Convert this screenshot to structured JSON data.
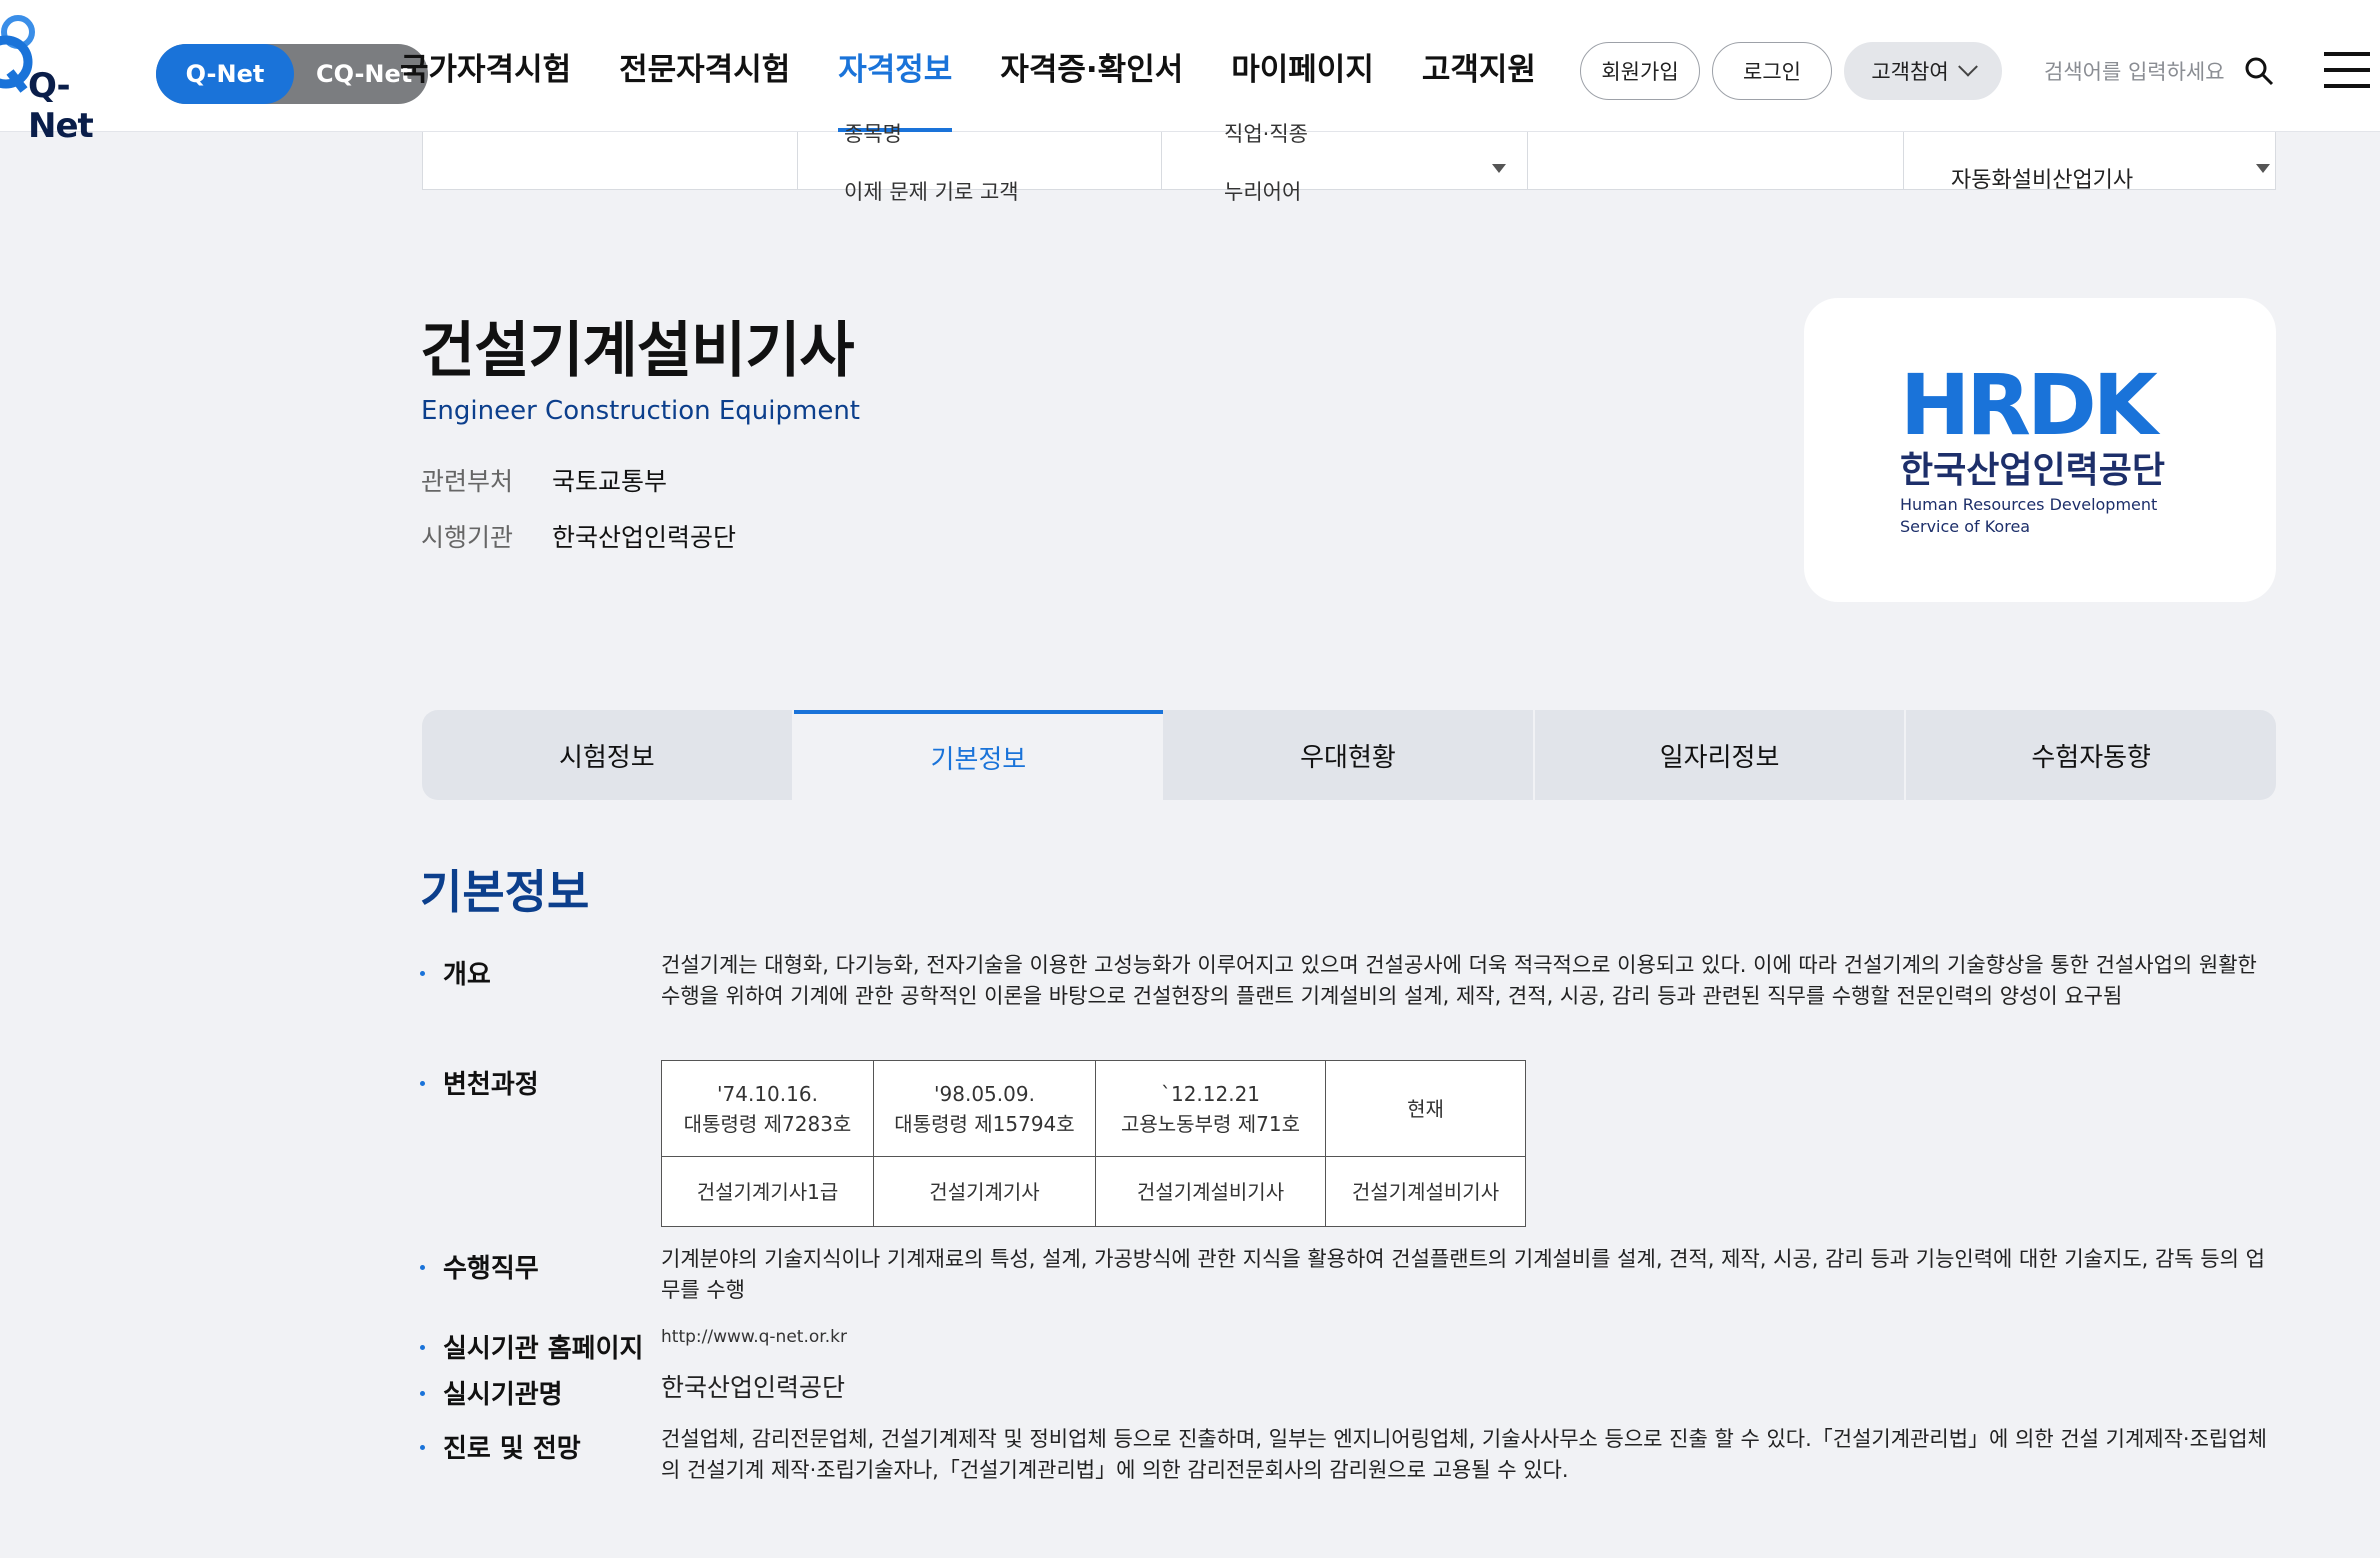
{
  "header": {
    "logo_text": "Q-Net",
    "net_switch": {
      "active": "Q-Net",
      "inactive": "CQ-Net"
    },
    "gnb": [
      "국가자격시험",
      "전문자격시험",
      "자격정보",
      "자격증·확인서",
      "마이페이지",
      "고객지원"
    ],
    "gnb_active_index": 2,
    "signup": "회원가입",
    "login": "로그인",
    "participation": "고객참여",
    "search_placeholder": "검색어를 입력하세요"
  },
  "form_strip": {
    "cut_text_1": "종목명",
    "cut_text_2": "직업·직종",
    "cut_text_3": "이제 문제 기로 고객",
    "cut_text_4": "누리어어",
    "selected_item": "자동화설비산업기사"
  },
  "qualification": {
    "title": "건설기계설비기사",
    "subtitle": "Engineer Construction Equipment",
    "meta": [
      {
        "label": "관련부처",
        "value": "국토교통부"
      },
      {
        "label": "시행기관",
        "value": "한국산업인력공단"
      }
    ],
    "org_logo": {
      "mark": "HRDK",
      "name_ko": "한국산업인력공단",
      "name_en_1": "Human Resources Development",
      "name_en_2": "Service of Korea",
      "color": "#1a73d9"
    }
  },
  "tabs": [
    "시험정보",
    "기본정보",
    "우대현황",
    "일자리정보",
    "수험자동향"
  ],
  "tabs_active_index": 1,
  "basic_info": {
    "section_title": "기본정보",
    "overview_label": "개요",
    "overview_text": "건설기계는 대형화, 다기능화, 전자기술을 이용한 고성능화가 이루어지고 있으며 건설공사에 더욱 적극적으로 이용되고 있다. 이에 따라 건설기계의 기술향상을 통한 건설사업의 원활한 수행을 위하여 기계에 관한 공학적인 이론을 바탕으로 건설현장의 플랜트 기계설비의 설계, 제작, 견적, 시공, 감리 등과 관련된 직무를 수행할 전문인력의 양성이 요구됨",
    "history_label": "변천과정",
    "history": [
      {
        "date": "'74.10.16.",
        "law": "대통령령 제7283호",
        "name": "건설기계기사1급"
      },
      {
        "date": "'98.05.09.",
        "law": "대통령령 제15794호",
        "name": "건설기계기사"
      },
      {
        "date": "`12.12.21",
        "law": "고용노동부령 제71호",
        "name": "건설기계설비기사"
      },
      {
        "date": "현재",
        "law": "",
        "name": "건설기계설비기사"
      }
    ],
    "duty_label": "수행직무",
    "duty_text": "기계분야의 기술지식이나 기계재료의 특성, 설계, 가공방식에 관한 지식을 활용하여 건설플랜트의 기계설비를 설계, 견적, 제작, 시공, 감리 등과 기능인력에 대한 기술지도, 감독 등의 업무를 수행",
    "homepage_label": "실시기관 홈페이지",
    "homepage_value": "http://www.q-net.or.kr",
    "agency_label": "실시기관명",
    "agency_value": "한국산업인력공단",
    "career_label": "진로 및 전망",
    "career_text": "건설업체, 감리전문업체, 건설기계제작 및 정비업체 등으로 진출하며, 일부는 엔지니어링업체, 기술사사무소 등으로 진출 할 수 있다.「건설기계관리법」에 의한 건설 기계제작·조립업체의 건설기계 제작·조립기술자나,「건설기계관리법」에 의한 감리전문회사의 감리원으로 고용될 수 있다."
  }
}
